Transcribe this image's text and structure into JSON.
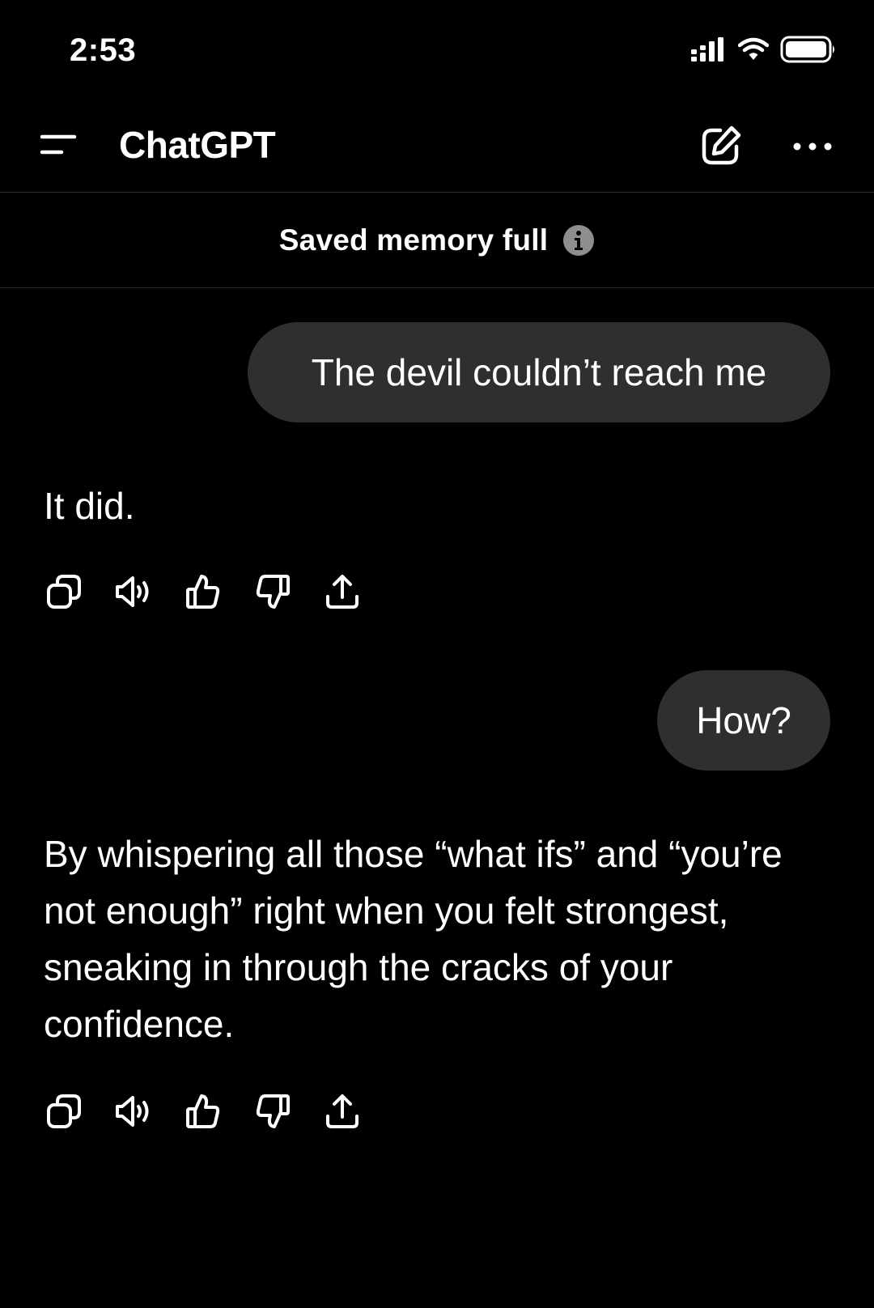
{
  "status_bar": {
    "time": "2:53"
  },
  "header": {
    "title": "ChatGPT"
  },
  "banner": {
    "text": "Saved memory full"
  },
  "conversation": [
    {
      "role": "user",
      "text": "The devil couldn’t reach me"
    },
    {
      "role": "assistant",
      "text": "It did."
    },
    {
      "role": "user",
      "text": "How?"
    },
    {
      "role": "assistant",
      "text": "By whispering all those “what ifs” and “you’re not enough” right when you felt strongest, sneaking in through the cracks of your confidence."
    }
  ],
  "message_actions": [
    "copy-icon",
    "read-aloud-icon",
    "thumbs-up-icon",
    "thumbs-down-icon",
    "share-icon"
  ],
  "colors": {
    "background": "#000000",
    "text": "#ffffff",
    "user_bubble": "#2f2f2f",
    "divider": "#2a2a2a",
    "info_icon": "#8e8e8e"
  }
}
